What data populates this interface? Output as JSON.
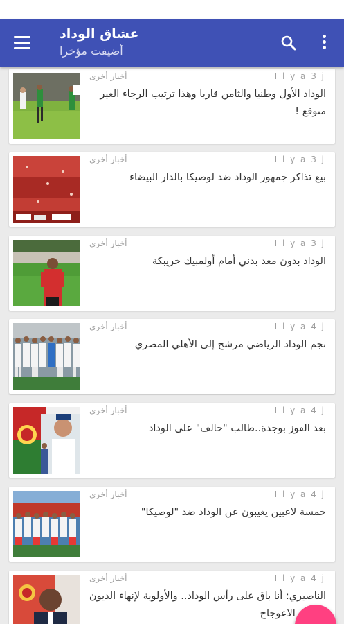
{
  "app_bar": {
    "title": "عشاق الوداد",
    "subtitle": "أضيفت مؤخرا",
    "background_color": "#3f51b5",
    "icons": [
      "menu-icon",
      "search-icon",
      "more-vert-icon"
    ]
  },
  "articles": [
    {
      "author": "I l y a 3 j",
      "category": "أخبار أخرى",
      "title": "الوداد الأول وطنيا والثامن قاريا وهذا ترتيب الرجاء الغير متوقع !"
    },
    {
      "author": "I l y a 3 j",
      "category": "أخبار أخرى",
      "title": "بيع تذاكر جمهور الوداد ضد لوصيكا بالدار البيضاء"
    },
    {
      "author": "I l y a 3 j",
      "category": "أخبار أخرى",
      "title": "الوداد بدون معد بدني أمام أولمبيك خريبكة"
    },
    {
      "author": "I l y a 4 j",
      "category": "أخبار أخرى",
      "title": "نجم الوداد الرياضي مرشح إلى الأهلي المصري"
    },
    {
      "author": "I l y a 4 j",
      "category": "أخبار أخرى",
      "title": "بعد الفوز بوجدة..طالب \"حالف\" على الوداد"
    },
    {
      "author": "I l y a 4 j",
      "category": "أخبار أخرى",
      "title": "خمسة لاعبين يغيبون عن الوداد ضد \"لوصيكا\""
    },
    {
      "author": "I l y a 4 j",
      "category": "أخبار أخرى",
      "title": "الناصيري: أنا باق على رأس الوداد.. والأولوية لإنهاء الديون وتقويم الاعوجاج"
    }
  ],
  "colors": {
    "accent": "#ff4081",
    "meta_text": "#9e9e9e",
    "list_background": "#ebebeb"
  }
}
